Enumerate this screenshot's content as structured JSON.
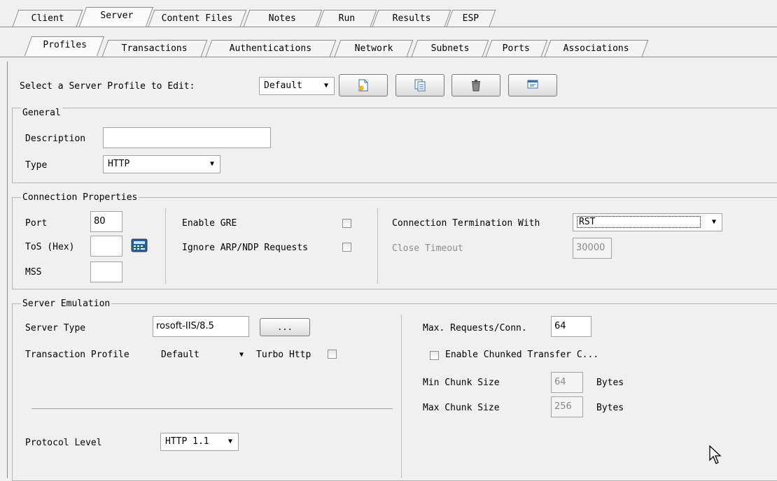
{
  "outer_tabs": [
    "Client",
    "Server",
    "Content Files",
    "Notes",
    "Run",
    "Results",
    "ESP"
  ],
  "outer_active": "Server",
  "inner_tabs": [
    "Profiles",
    "Transactions",
    "Authentications",
    "Network",
    "Subnets",
    "Ports",
    "Associations"
  ],
  "inner_active": "Profiles",
  "profile": {
    "label": "Select a Server Profile to Edit:",
    "selected": "Default",
    "buttons": [
      "new-profile-icon",
      "copy-profile-icon",
      "delete-profile-icon",
      "rename-profile-icon"
    ]
  },
  "general": {
    "title": "General",
    "description_label": "Description",
    "description_value": "",
    "type_label": "Type",
    "type_value": "HTTP"
  },
  "connection": {
    "title": "Connection Properties",
    "port_label": "Port",
    "port_value": "80",
    "tos_label": "ToS (Hex)",
    "tos_value": "",
    "mss_label": "MSS",
    "mss_value": "",
    "gre_label": "Enable GRE",
    "arp_label": "Ignore ARP/NDP Requests",
    "termination_label": "Connection Termination With",
    "termination_value": "RST",
    "close_timeout_label": "Close Timeout",
    "close_timeout_value": "30000"
  },
  "emulation": {
    "title": "Server Emulation",
    "server_type_label": "Server Type",
    "server_type_value": "rosoft-IIS/8.5",
    "browse_label": "...",
    "transaction_profile_label": "Transaction Profile",
    "transaction_profile_value": "Default",
    "turbo_label": "Turbo Http",
    "protocol_label": "Protocol Level",
    "protocol_value": "HTTP 1.1",
    "max_requests_label": "Max. Requests/Conn.",
    "max_requests_value": "64",
    "chunked_label": "Enable Chunked Transfer C...",
    "min_chunk_label": "Min Chunk Size",
    "min_chunk_value": "64",
    "max_chunk_label": "Max Chunk Size",
    "max_chunk_value": "256",
    "bytes_label": "Bytes"
  }
}
